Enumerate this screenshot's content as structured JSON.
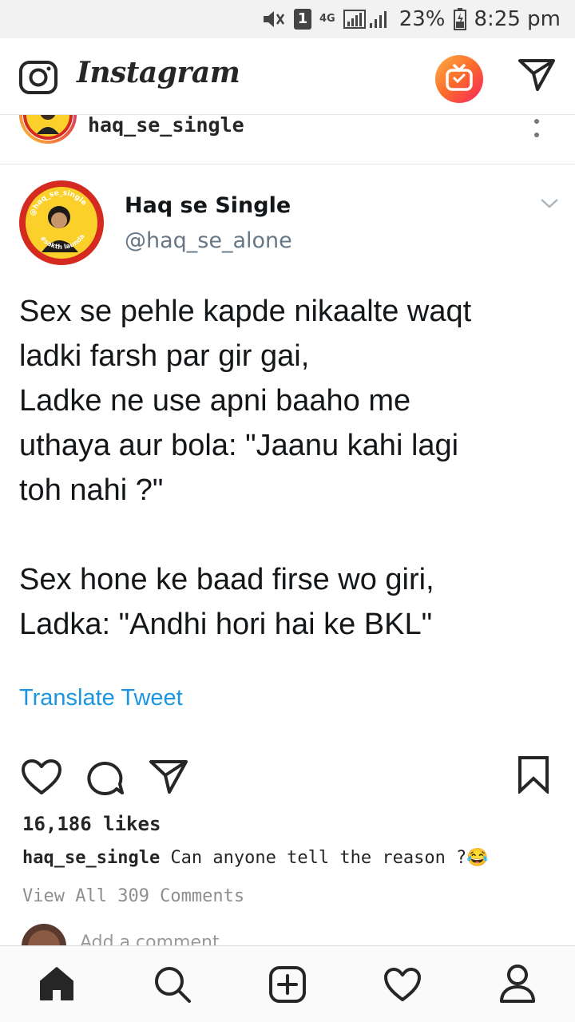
{
  "status_bar": {
    "battery": "23%",
    "time": "8:25 pm",
    "sim_badge": "1",
    "network": "4G"
  },
  "app": {
    "title": "Instagram"
  },
  "post": {
    "username": "haq_se_single",
    "tweet": {
      "name": "Haq se Single",
      "handle": "@haq_se_alone",
      "text": "Sex se pehle kapde nikaalte waqt\nladki farsh par gir gai,\nLadke ne use apni baaho me\nuthaya aur bola: \"Jaanu kahi lagi\ntoh nahi ?\"\n\nSex hone ke baad firse wo giri,\nLadka: \"Andhi hori hai ke BKL\"",
      "translate_label": "Translate Tweet",
      "avatar_badge_top": "@haq_se_single",
      "avatar_badge_bottom": "#sakth launda"
    },
    "likes": "16,186 likes",
    "caption_user": "haq_se_single",
    "caption_text": "Can anyone tell the reason ?",
    "caption_emoji": "😂",
    "view_comments": "View All 309 Comments",
    "add_comment_placeholder": "Add a comment..."
  },
  "colors": {
    "link_blue": "#1b95e0",
    "igtv_gradient": [
      "#fc8d2c",
      "#f5225f"
    ],
    "avatar_yellow": "#fbd02a",
    "avatar_red": "#d42a1f"
  },
  "icons": {
    "top_bar": [
      "camera-icon",
      "igtv-icon",
      "direct-message-icon"
    ],
    "actions": [
      "heart-icon",
      "comment-icon",
      "share-icon",
      "bookmark-icon"
    ],
    "bottom_nav": [
      "home-icon",
      "search-icon",
      "add-post-icon",
      "activity-heart-icon",
      "profile-icon"
    ]
  }
}
